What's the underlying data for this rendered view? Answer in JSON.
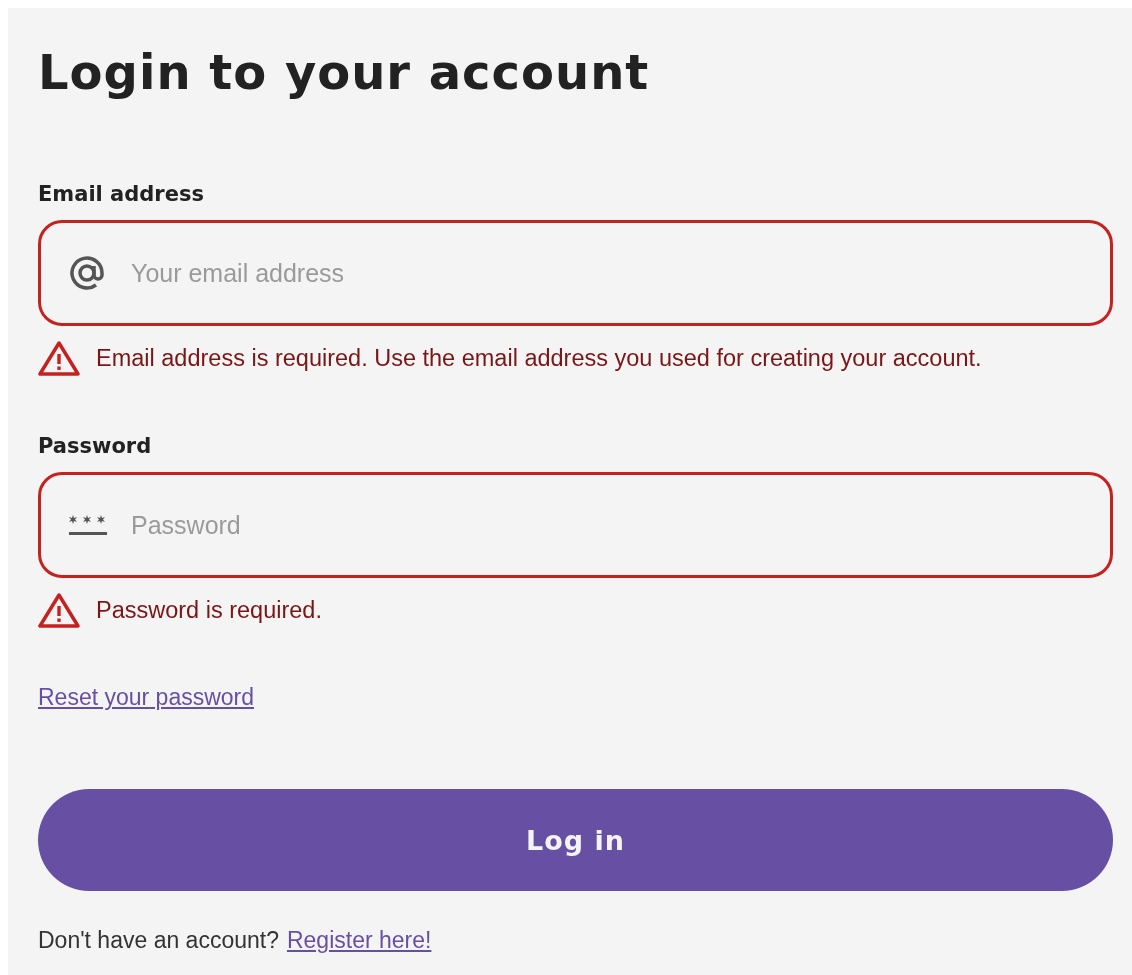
{
  "title": "Login to your account",
  "fields": [
    {
      "kind": "email",
      "label": "Email address",
      "placeholder": "Your email address",
      "invalid": true,
      "error": "Email address is required. Use the email address you used for creating your account."
    },
    {
      "kind": "password",
      "label": "Password",
      "placeholder": "Password",
      "invalid": true,
      "error": "Password is required."
    }
  ],
  "reset_link": "Reset your password",
  "submit_button": "Log in",
  "register": {
    "text": "Don't have an account?",
    "link": "Register here!"
  }
}
